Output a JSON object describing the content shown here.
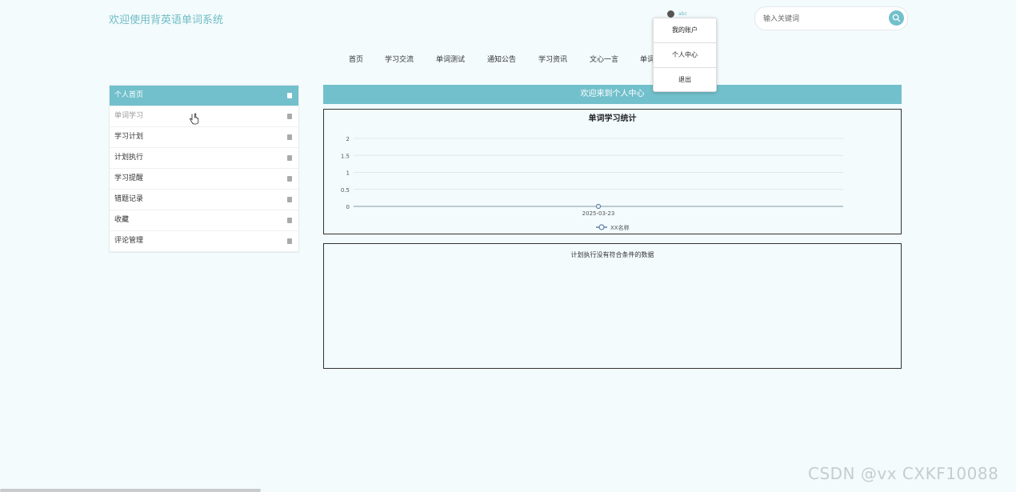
{
  "header": {
    "title": "欢迎使用背英语单词系统",
    "username": "abc",
    "search_placeholder": "输入关键词"
  },
  "user_menu": {
    "items": [
      {
        "label": "我的账户"
      },
      {
        "label": "个人中心"
      },
      {
        "label": "退出"
      }
    ]
  },
  "nav": {
    "items": [
      {
        "label": "首页"
      },
      {
        "label": "学习交流"
      },
      {
        "label": "单词测试"
      },
      {
        "label": "通知公告"
      },
      {
        "label": "学习资讯"
      },
      {
        "label": "文心一言"
      },
      {
        "label": "单词"
      }
    ]
  },
  "sidebar": {
    "items": [
      {
        "label": "个人首页",
        "state": "active"
      },
      {
        "label": "单词学习",
        "state": "hover"
      },
      {
        "label": "学习计划",
        "state": ""
      },
      {
        "label": "计划执行",
        "state": ""
      },
      {
        "label": "学习提醒",
        "state": ""
      },
      {
        "label": "错题记录",
        "state": ""
      },
      {
        "label": "收藏",
        "state": ""
      },
      {
        "label": "评论管理",
        "state": ""
      }
    ]
  },
  "main": {
    "welcome": "欢迎来到个人中心",
    "empty_message": "计划执行没有符合条件的数据"
  },
  "chart_data": {
    "type": "line",
    "title": "单词学习统计",
    "categories": [
      "2025-03-23"
    ],
    "series": [
      {
        "name": "XX名称",
        "values": [
          0
        ]
      }
    ],
    "yticks": [
      "0",
      "0.5",
      "1",
      "1.5",
      "2"
    ],
    "ylim": [
      0,
      2
    ],
    "grid": true,
    "legend": "bottom-center"
  },
  "watermark": "CSDN @vx  CXKF10088",
  "colors": {
    "accent": "#72c0cb",
    "background": "#f3fbfc",
    "line": "#5b7fa6"
  },
  "icons": {
    "search": "search-icon",
    "sidebar": "file-icon",
    "avatar": "avatar"
  }
}
